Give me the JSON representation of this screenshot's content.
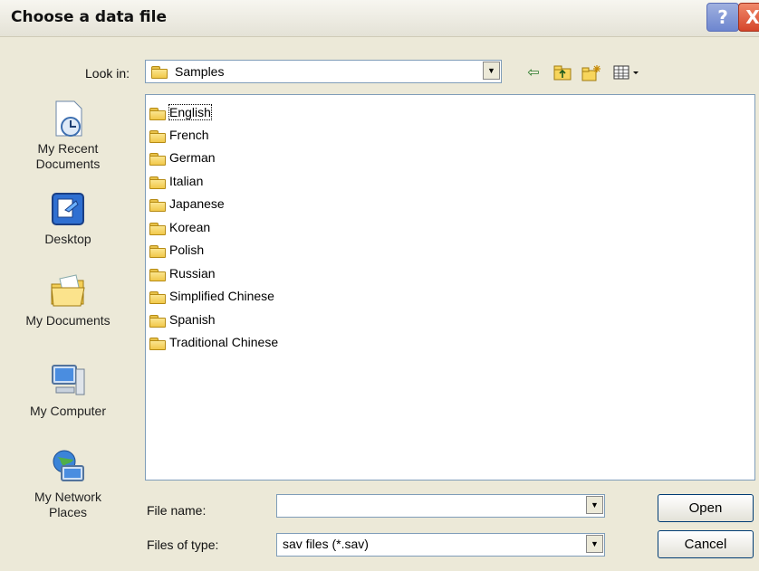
{
  "window": {
    "title": "Choose a data file",
    "help": "?",
    "close": "X"
  },
  "look_in": {
    "label": "Look in:",
    "value": "Samples"
  },
  "toolbar": {
    "back": "back-icon",
    "up": "up-folder-icon",
    "new_folder": "new-folder-icon",
    "views": "views-menu-icon"
  },
  "places": [
    {
      "label": "My Recent Documents",
      "line1": "My Recent",
      "line2": "Documents",
      "icon": "recent-documents-icon"
    },
    {
      "label": "Desktop",
      "line1": "Desktop",
      "line2": "",
      "icon": "desktop-icon"
    },
    {
      "label": "My Documents",
      "line1": "My Documents",
      "line2": "",
      "icon": "my-documents-icon"
    },
    {
      "label": "My Computer",
      "line1": "My Computer",
      "line2": "",
      "icon": "my-computer-icon"
    },
    {
      "label": "My Network Places",
      "line1": "My Network",
      "line2": "Places",
      "icon": "network-places-icon"
    }
  ],
  "folders": [
    "English",
    "French",
    "German",
    "Italian",
    "Japanese",
    "Korean",
    "Polish",
    "Russian",
    "Simplified Chinese",
    "Spanish",
    "Traditional Chinese"
  ],
  "file_name": {
    "label": "File name:",
    "value": ""
  },
  "file_type": {
    "label": "Files of type:",
    "value": "sav files (*.sav)"
  },
  "buttons": {
    "open": "Open",
    "cancel": "Cancel"
  },
  "colors": {
    "list_border": "#7f9db9",
    "dialog_bg": "#ece9d8",
    "button_border": "#003c74"
  }
}
